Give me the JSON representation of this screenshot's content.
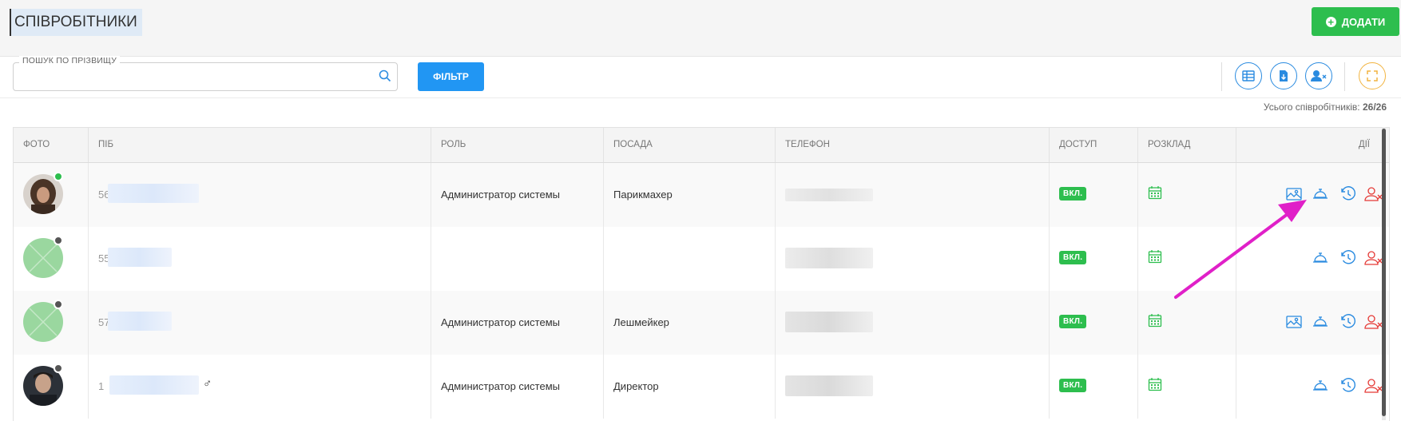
{
  "header": {
    "title": "СПІВРОБІТНИКИ",
    "add_button": "ДОДАТИ"
  },
  "toolbar": {
    "search_label": "ПОШУК ПО ПРІЗВИЩУ",
    "search_value": "",
    "filter_button": "ФІЛЬТР",
    "tool_icons": [
      "columns-icon",
      "download-icon",
      "user-remove-icon",
      "fullscreen-icon"
    ]
  },
  "summary": {
    "label": "Усього співробітників:",
    "count": "26/26"
  },
  "table": {
    "columns": [
      "ФОТО",
      "ПІБ",
      "РОЛЬ",
      "ПОСАДА",
      "ТЕЛЕФОН",
      "ДОСТУП",
      "РОЗКЛАД",
      "ДІЇ"
    ],
    "rows": [
      {
        "name_prefix": "56",
        "role": "Администратор системы",
        "position": "Парикмахер",
        "access": "ВКЛ.",
        "online": true,
        "gender": ""
      },
      {
        "name_prefix": "55",
        "role": "",
        "position": "",
        "access": "ВКЛ.",
        "online": false,
        "gender": ""
      },
      {
        "name_prefix": "57",
        "role": "Администратор системы",
        "position": "Лешмейкер",
        "access": "ВКЛ.",
        "online": false,
        "gender": ""
      },
      {
        "name_prefix": "1",
        "role": "Администратор системы",
        "position": "Директор",
        "access": "ВКЛ.",
        "online": false,
        "gender": "♂"
      }
    ]
  },
  "colors": {
    "primary": "#2196f3",
    "success": "#2dbe4e",
    "danger": "#e53935",
    "annotation_arrow": "#e020c8"
  }
}
